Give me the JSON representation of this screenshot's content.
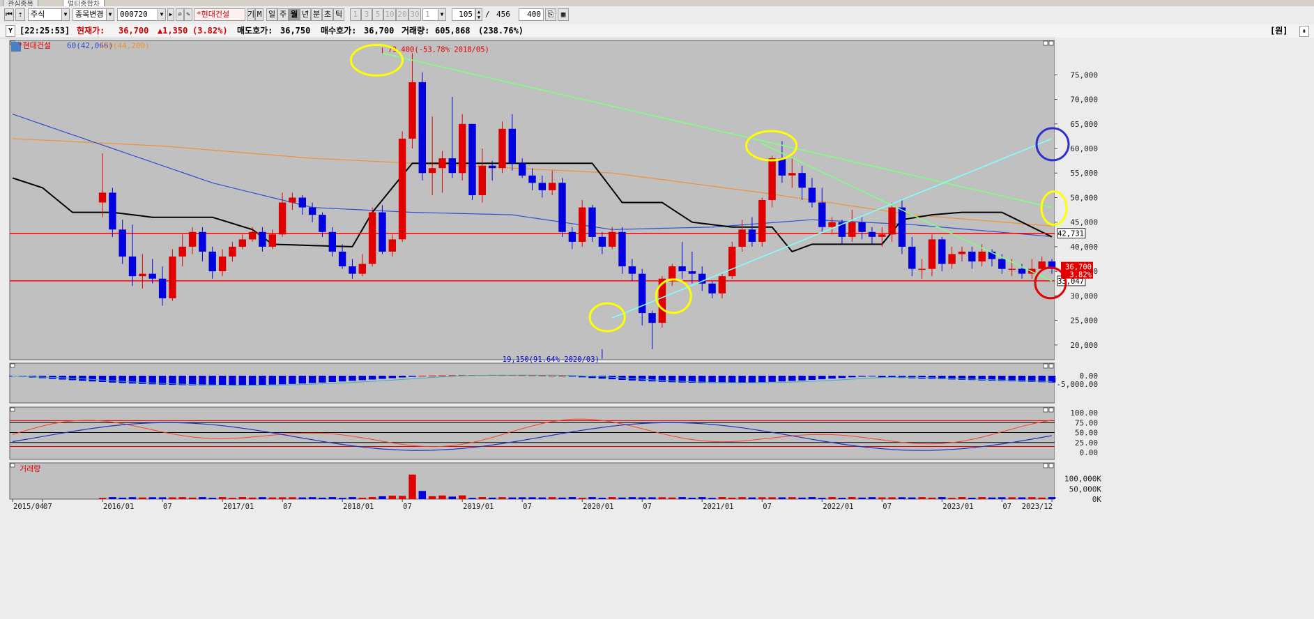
{
  "tabs": [
    "관심종목",
    "멀티종합차"
  ],
  "toolbar": {
    "market": "주식",
    "change_item": "종목변경",
    "code": "000720",
    "name": "*현대건설",
    "btn_gi": "기",
    "btn_m": "M",
    "periods": [
      "일",
      "주",
      "월",
      "년",
      "분",
      "초",
      "틱"
    ],
    "active_period": "월",
    "intervals": [
      "1",
      "3",
      "5",
      "10",
      "20",
      "30"
    ],
    "interval_value": "1",
    "position": "105",
    "separator": "/",
    "total": "456",
    "count": "400"
  },
  "info": {
    "time": "[22:25:53]",
    "price_label": "현재가:",
    "price": "36,700",
    "change": "▲1,350",
    "change_pct": "(3.82%)",
    "ask_label": "매도호가:",
    "ask": "36,750",
    "bid_label": "매수호가:",
    "bid": "36,700",
    "volume_label": "거래량:",
    "volume": "605,868",
    "volume_pct": "(238.76%)",
    "unit_button": "[원]"
  },
  "colors": {
    "up": "#e00000",
    "down": "#0000e0",
    "ma60": "#3050d0",
    "ma120": "#f09030",
    "cloud": "#000000",
    "hline": "#ff0000",
    "trend_green": "#80ff80",
    "trend_cyan": "#80ffff",
    "panel_bg": "#c0c0c0",
    "highlight_yellow": "#ffff00",
    "highlight_blue": "#3030d0",
    "highlight_red": "#e00000"
  },
  "chart_data": [
    {
      "type": "candlestick",
      "legend": [
        {
          "name": "*현대건설",
          "color": "#e00000"
        },
        {
          "name": "60(42,066)",
          "color": "#3050d0"
        },
        {
          "name": "120(44,200)",
          "color": "#f09030"
        }
      ],
      "ylim": [
        17000,
        82000
      ],
      "yticks": [
        20000,
        25000,
        30000,
        35000,
        40000,
        45000,
        50000,
        55000,
        60000,
        65000,
        70000,
        75000
      ],
      "ytick_labels": [
        "20,000",
        "25,000",
        "30,000",
        "35,000",
        "40,000",
        "45,000",
        "50,000",
        "55,000",
        "60,000",
        "65,000",
        "70,000",
        "75,000"
      ],
      "xtick_labels": [
        "2015/04",
        "07",
        "2016/01",
        "07",
        "2017/01",
        "07",
        "2018/01",
        "07",
        "2019/01",
        "07",
        "2020/01",
        "07",
        "2021/01",
        "07",
        "2022/01",
        "07",
        "2023/01",
        "07",
        "2023/12"
      ],
      "xtick_months": [
        0,
        3,
        9,
        15,
        21,
        27,
        33,
        39,
        45,
        51,
        57,
        63,
        69,
        75,
        81,
        87,
        93,
        99,
        104
      ],
      "high_annotation": {
        "month": 37,
        "value": 79400,
        "text": "79,400(-53.78% 2018/05)"
      },
      "low_annotation": {
        "month": 59,
        "value": 19150,
        "text": "19,150(91.64% 2020/03)"
      },
      "hlines": [
        {
          "value": 42731,
          "label": "42,731"
        },
        {
          "value": 33047,
          "label": "33,047"
        }
      ],
      "last_price_label": "36,700",
      "last_change_label": "3.82%",
      "trendlines": [
        {
          "color": "green",
          "from": [
            37,
            79400
          ],
          "to": [
            104,
            48000
          ]
        },
        {
          "color": "green",
          "from": [
            75,
            61000
          ],
          "to": [
            104,
            33000
          ]
        },
        {
          "color": "cyan",
          "from": [
            60,
            25500
          ],
          "to": [
            104,
            62000
          ]
        }
      ],
      "closes": [
        51000,
        43500,
        38000,
        34000,
        34500,
        33500,
        29500,
        38000,
        40000,
        43000,
        39000,
        35000,
        38000,
        40000,
        41500,
        43000,
        40000,
        42500,
        49000,
        50000,
        48000,
        46500,
        43000,
        39000,
        36000,
        34500,
        36500,
        47000,
        39000,
        41500,
        62000,
        73500,
        55000,
        56000,
        58000,
        55000,
        65000,
        50500,
        56500,
        56000,
        64000,
        57000,
        54500,
        53000,
        51500,
        53000,
        43000,
        41000,
        48000,
        42000,
        40000,
        43000,
        36000,
        34500,
        26500,
        24500,
        33500,
        36000,
        35000,
        34500,
        32500,
        30500,
        34000,
        40000,
        43500,
        41000,
        49500,
        58000,
        54500,
        55000,
        52000,
        49000,
        44000,
        45000,
        42000,
        45000,
        43000,
        42000,
        42500,
        48000,
        40000,
        35500,
        35500,
        41500,
        36500,
        38500,
        39000,
        37000,
        39000,
        37500,
        35500,
        35500,
        34500,
        35500,
        37000,
        35500
      ],
      "opens": [
        49000,
        51000,
        43500,
        38000,
        34000,
        34500,
        33500,
        29500,
        38000,
        40000,
        43000,
        39000,
        35000,
        38000,
        40000,
        41500,
        43000,
        40000,
        42500,
        49000,
        50000,
        48000,
        46500,
        43000,
        39000,
        36000,
        34500,
        36500,
        47000,
        39000,
        41500,
        62000,
        73500,
        55000,
        56000,
        58000,
        55000,
        65000,
        50500,
        56500,
        56000,
        64000,
        57000,
        54500,
        53000,
        51500,
        53000,
        43000,
        41000,
        48000,
        42000,
        40000,
        43000,
        36000,
        34500,
        26500,
        24500,
        33500,
        36000,
        35000,
        34500,
        32500,
        30500,
        34000,
        40000,
        43500,
        41000,
        49500,
        58000,
        54500,
        55000,
        52000,
        49000,
        44000,
        45000,
        42000,
        45000,
        43000,
        42000,
        42500,
        48000,
        40000,
        35500,
        35500,
        41500,
        36500,
        38500,
        39000,
        37000,
        39000,
        37500,
        35500,
        35500,
        34500,
        35500,
        37000
      ],
      "highs": [
        59000,
        52000,
        45500,
        44500,
        38500,
        37500,
        36000,
        39500,
        42500,
        44000,
        44000,
        40000,
        39500,
        41000,
        42500,
        44000,
        44000,
        43500,
        51000,
        51000,
        50500,
        49000,
        47000,
        44000,
        40500,
        37500,
        38500,
        48000,
        48500,
        42500,
        63500,
        79400,
        75500,
        66500,
        59500,
        70500,
        67000,
        64500,
        60000,
        57500,
        65500,
        67000,
        58000,
        56000,
        54500,
        55500,
        54000,
        44000,
        49500,
        48500,
        43000,
        44000,
        44000,
        37500,
        35500,
        27000,
        34000,
        36500,
        41000,
        39000,
        36000,
        33000,
        34500,
        41000,
        45500,
        46000,
        50000,
        58500,
        61500,
        58000,
        56500,
        54000,
        52000,
        46000,
        45500,
        47500,
        46000,
        44000,
        44000,
        49000,
        49500,
        42000,
        37500,
        42500,
        42000,
        40000,
        40000,
        40000,
        40500,
        39500,
        38500,
        37500,
        36500,
        37500,
        38000,
        37500
      ],
      "lows": [
        46000,
        42000,
        36500,
        32000,
        31500,
        32500,
        28000,
        29000,
        36000,
        38500,
        37000,
        33500,
        34000,
        37000,
        39500,
        41000,
        39000,
        39500,
        42000,
        47500,
        46500,
        45000,
        42000,
        38000,
        35500,
        33500,
        34000,
        36000,
        38500,
        38000,
        41000,
        60000,
        53500,
        50500,
        51000,
        54000,
        53500,
        49500,
        49000,
        53500,
        55000,
        55500,
        54000,
        51500,
        50000,
        50500,
        42000,
        39500,
        40000,
        41000,
        38500,
        39500,
        34500,
        33000,
        24000,
        19150,
        23500,
        32000,
        33500,
        32500,
        31000,
        29500,
        29500,
        33500,
        39000,
        40000,
        40000,
        48000,
        53000,
        52000,
        49500,
        48000,
        43000,
        42500,
        40500,
        41000,
        41500,
        40500,
        40000,
        41000,
        38500,
        34000,
        33500,
        34000,
        35000,
        35500,
        37000,
        35500,
        36000,
        36000,
        34500,
        34000,
        33500,
        33500,
        35000,
        34500
      ],
      "ma60_anchors": [
        [
          0,
          67000
        ],
        [
          10,
          60000
        ],
        [
          20,
          53000
        ],
        [
          30,
          48000
        ],
        [
          40,
          47000
        ],
        [
          50,
          46500
        ],
        [
          60,
          43500
        ],
        [
          70,
          44000
        ],
        [
          80,
          45500
        ],
        [
          90,
          44500
        ],
        [
          104,
          42066
        ]
      ],
      "ma120_anchors": [
        [
          0,
          62000
        ],
        [
          15,
          60500
        ],
        [
          30,
          58000
        ],
        [
          45,
          56500
        ],
        [
          60,
          55000
        ],
        [
          75,
          51000
        ],
        [
          90,
          46500
        ],
        [
          104,
          44200
        ]
      ],
      "cloud_anchors": [
        [
          0,
          54000
        ],
        [
          3,
          52000
        ],
        [
          6,
          47000
        ],
        [
          10,
          47000
        ],
        [
          14,
          46000
        ],
        [
          20,
          46000
        ],
        [
          24,
          43500
        ],
        [
          26,
          40500
        ],
        [
          34,
          40000
        ],
        [
          36,
          47000
        ],
        [
          40,
          57000
        ],
        [
          58,
          57000
        ],
        [
          61,
          49000
        ],
        [
          65,
          49000
        ],
        [
          68,
          45000
        ],
        [
          72,
          44000
        ],
        [
          76,
          44000
        ],
        [
          78,
          39000
        ],
        [
          80,
          40500
        ],
        [
          87,
          40500
        ],
        [
          89,
          45500
        ],
        [
          92,
          46500
        ],
        [
          95,
          47000
        ],
        [
          99,
          47000
        ],
        [
          103,
          43000
        ],
        [
          104,
          42000
        ]
      ]
    },
    {
      "type": "bar",
      "name": "MACD histogram",
      "yticks": [
        0,
        -5000
      ],
      "ytick_labels": [
        "0.00",
        "-5,000.00"
      ]
    },
    {
      "type": "line",
      "name": "Stochastic",
      "yticks": [
        100,
        75,
        50,
        25,
        0
      ],
      "ytick_labels": [
        "100.00",
        "75.00",
        "50.00",
        "25.00",
        "0.00"
      ]
    },
    {
      "type": "bar",
      "legend": [
        {
          "name": "거래량",
          "color": "#e00000"
        }
      ],
      "yticks": [
        100000,
        50000,
        0
      ],
      "ytick_labels": [
        "100,000K",
        "50,000K",
        "0K"
      ]
    }
  ]
}
